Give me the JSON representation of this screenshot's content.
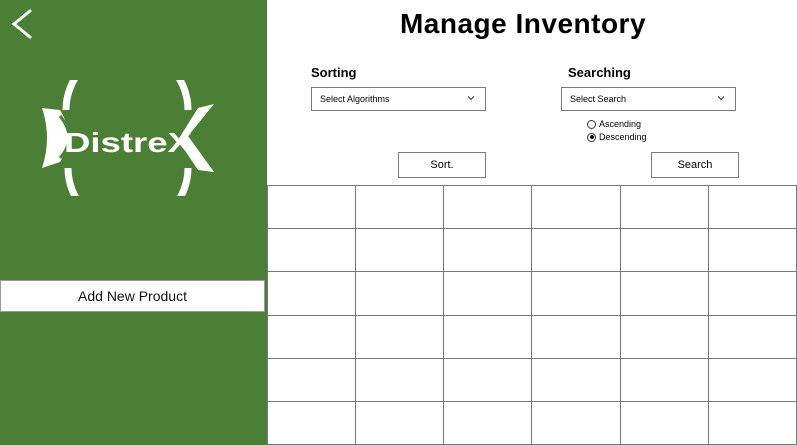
{
  "title": "Manage Inventory",
  "sidebar": {
    "back_icon": "chevron-left-icon",
    "logo_text": "DistreX",
    "add_product_label": "Add New Product",
    "bg_color": "#4a7f35"
  },
  "sorting": {
    "label": "Sorting",
    "select_value": "Select Algorithms",
    "button_label": "Sort."
  },
  "searching": {
    "label": "Searching",
    "select_value": "Select Search",
    "options": [
      {
        "label": "Ascending",
        "checked": false
      },
      {
        "label": "Descending",
        "checked": true
      }
    ],
    "button_label": "Search"
  },
  "table": {
    "columns": 6,
    "rows": 6
  }
}
